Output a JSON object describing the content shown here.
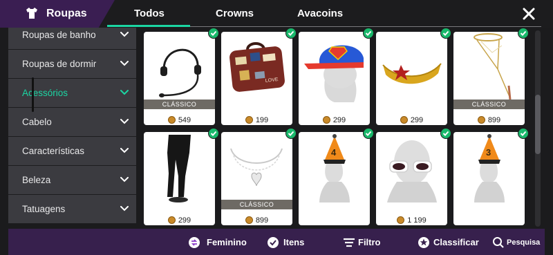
{
  "header": {
    "category_label": "Roupas",
    "category_icon": "shirt-icon",
    "tabs": [
      {
        "label": "Todos",
        "active": true
      },
      {
        "label": "Crowns",
        "active": false
      },
      {
        "label": "Avacoins",
        "active": false
      }
    ],
    "close_icon": "close-icon",
    "accent_color": "#1bd6a3"
  },
  "sidebar": {
    "items": [
      {
        "label": "Roupas de banho"
      },
      {
        "label": "Roupas de dormir"
      },
      {
        "label": "Acessórios",
        "active": true
      },
      {
        "label": "Cabelo"
      },
      {
        "label": "Características"
      },
      {
        "label": "Beleza"
      },
      {
        "label": "Tatuagens"
      }
    ]
  },
  "items": [
    {
      "name": "headset",
      "price": "549",
      "badge": "CLÁSSICO",
      "owned": true
    },
    {
      "name": "suitcase",
      "price": "199",
      "badge": "",
      "owned": true
    },
    {
      "name": "superman cap",
      "price": "299",
      "badge": "",
      "owned": true
    },
    {
      "name": "wonder woman tiara",
      "price": "299",
      "badge": "",
      "owned": true
    },
    {
      "name": "halo",
      "price": "899",
      "badge": "CLÁSSICO",
      "owned": true
    },
    {
      "name": "black tights",
      "price": "299",
      "badge": "",
      "owned": true
    },
    {
      "name": "heart necklace",
      "price": "899",
      "badge": "CLÁSSICO",
      "owned": true
    },
    {
      "name": "party hat 4",
      "price": "",
      "badge": "",
      "owned": true
    },
    {
      "name": "white sunglasses",
      "price": "1 199",
      "badge": "",
      "owned": true
    },
    {
      "name": "party hat 3",
      "price": "",
      "badge": "",
      "owned": true
    }
  ],
  "bottom_bar": {
    "gender_label": "Feminino",
    "items_label": "Itens",
    "filter_label": "Filtro",
    "sort_label": "Classificar",
    "search_label": "Pesquisa"
  }
}
